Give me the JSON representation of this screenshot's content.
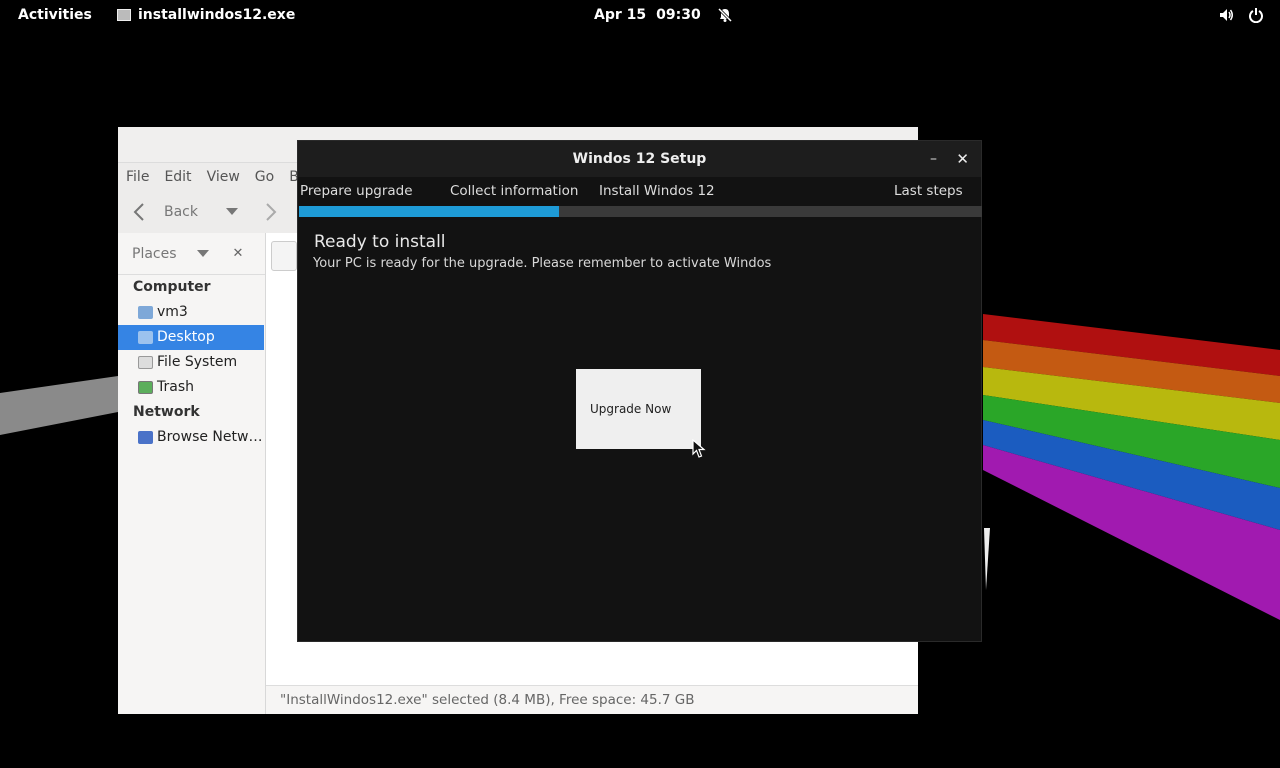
{
  "topbar": {
    "activities": "Activities",
    "app_name": "installwindos12.exe",
    "date": "Apr 15",
    "time": "09:30",
    "icons": [
      "notifications-off-icon",
      "volume-icon",
      "power-icon"
    ]
  },
  "file_manager": {
    "menu": [
      "File",
      "Edit",
      "View",
      "Go",
      "B"
    ],
    "toolbar": {
      "back_label": "Back"
    },
    "sidebar": {
      "places_label": "Places",
      "sections": [
        {
          "title": "Computer",
          "items": [
            {
              "label": "vm3",
              "icon": "home-folder-icon"
            },
            {
              "label": "Desktop",
              "icon": "desktop-folder-icon",
              "selected": true
            },
            {
              "label": "File System",
              "icon": "drive-icon"
            },
            {
              "label": "Trash",
              "icon": "trash-icon"
            }
          ]
        },
        {
          "title": "Network",
          "items": [
            {
              "label": "Browse Netw…",
              "icon": "network-icon"
            }
          ]
        }
      ]
    },
    "status": "\"InstallWindos12.exe\" selected (8.4 MB), Free space: 45.7 GB"
  },
  "setup": {
    "title": "Windos 12 Setup",
    "steps": [
      "Prepare upgrade",
      "Collect information",
      "Install Windos 12",
      "Last steps"
    ],
    "progress_fraction": 0.38,
    "heading": "Ready to install",
    "description": "Your PC is ready for the upgrade. Please remember to activate Windos",
    "button": "Upgrade Now",
    "accent": "#1e9bd7"
  }
}
